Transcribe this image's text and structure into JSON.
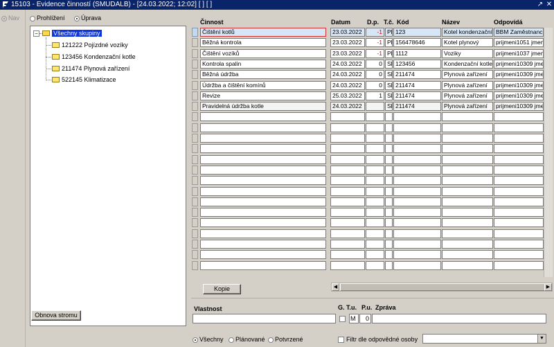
{
  "window": {
    "title": "15103 - Evidence činností (SMUDALB) - [24.03.2022; 12:02]  [ ]  [ ]",
    "controls": [
      "↗",
      "✕"
    ]
  },
  "rail": {
    "nav_label": "Nav"
  },
  "mode": {
    "view_label": "Prohlížení",
    "edit_label": "Úprava",
    "selected": "Úprava"
  },
  "tree": {
    "root": "Všechny skupiny",
    "items": [
      "121222 Pojízdné vozíky",
      "123456 Kondenzační kotle",
      "211474 Plynová zařízení",
      "522145 Klimatizace"
    ]
  },
  "refresh_button": "Obnova stromu",
  "grid": {
    "headers": {
      "cinnost": "Činnost",
      "datum": "Datum",
      "dp": "D.p.",
      "tc": "T.č.",
      "kod": "Kód",
      "nazev": "Název",
      "odpovida": "Odpovídá"
    },
    "rows": [
      [
        "Čištění kotlů",
        "23.03.2022",
        "-1",
        "Pl",
        "123",
        "Kotel kondenzační",
        "BBM Zaměstnanc"
      ],
      [
        "Běžná kontrola",
        "23.03.2022",
        "-1",
        "Pl",
        "156478646",
        "Kotel plynový",
        "prijmeni1051 jmen"
      ],
      [
        "Čištění vozíků",
        "23.03.2022",
        "-1",
        "Pl",
        "1112",
        "Voziky",
        "prijmeni1037 jmen"
      ],
      [
        "Kontrola spalin",
        "24.03.2022",
        "0",
        "Sl",
        "123456",
        "Kondenzační kotle",
        "prijmeni10309 jme"
      ],
      [
        "Běžná údržba",
        "24.03.2022",
        "0",
        "Sl",
        "211474",
        "Plynová zařízení",
        "prijmeni10309 jme"
      ],
      [
        "Údržba a čištění komínů",
        "24.03.2022",
        "0",
        "Sl",
        "211474",
        "Plynová zařízení",
        "prijmeni10309 jme"
      ],
      [
        "Revize",
        "25.03.2022",
        "1",
        "Sl",
        "211474",
        "Plynová zařízení",
        "prijmeni10309 jme"
      ],
      [
        "Pravidelná údržba kotle",
        "24.03.2022",
        "",
        "Sl",
        "211474",
        "Plynová zařízení",
        "prijmeni10309 jme"
      ]
    ]
  },
  "copy_button": "Kopie",
  "bottom": {
    "vlastnost_label": "Vlastnost",
    "gtu_label": "G. T.u.",
    "pu_label": "P.u.",
    "zprava_label": "Zpráva",
    "tu_value": "M",
    "pu_value": "0",
    "filter": {
      "all": "Všechny",
      "planned": "Plánované",
      "confirmed": "Potvrzené",
      "selected": "Všechny"
    },
    "resp_filter_label": "Filtr dle odpovědné osoby"
  },
  "colors": {
    "titlebar": "#0a246a",
    "selection": "#0a34e0",
    "selected_row": "#d6e6f7",
    "negative": "#e00000"
  }
}
